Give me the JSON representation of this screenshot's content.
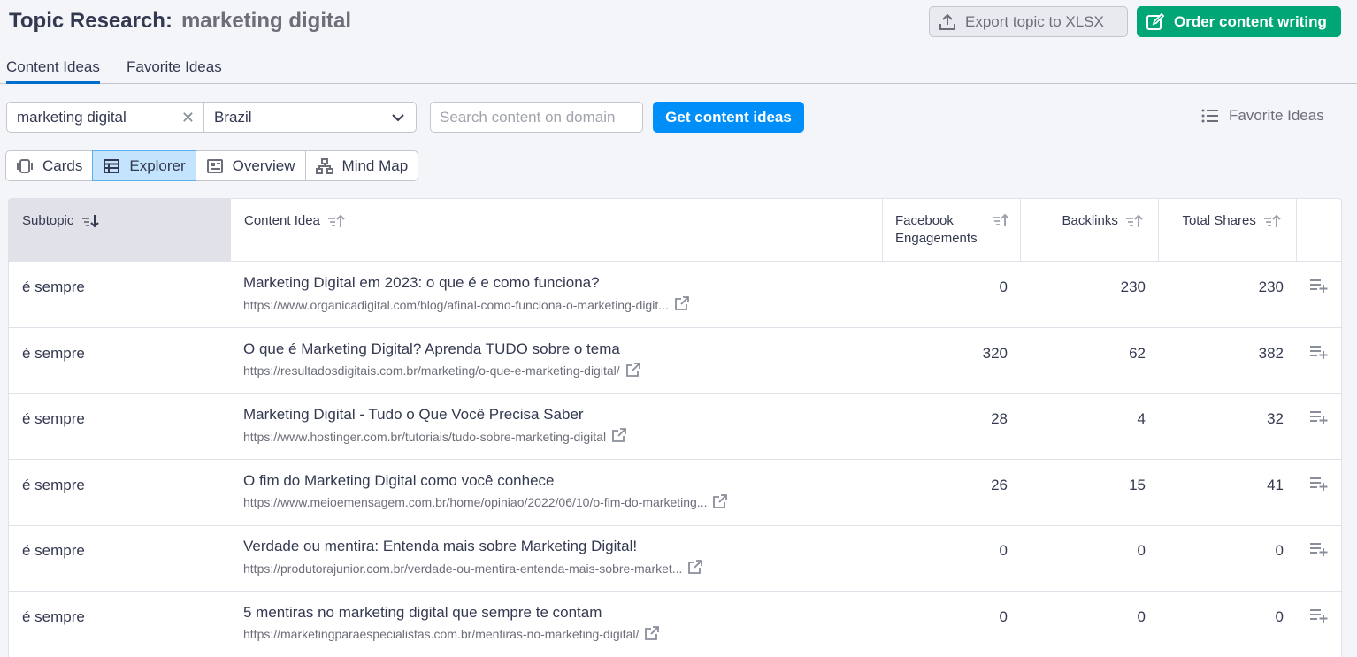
{
  "header": {
    "title": "Topic Research:",
    "keyword": "marketing digital",
    "export_label": "Export topic to XLSX",
    "order_label": "Order content writing"
  },
  "tabs": [
    {
      "label": "Content Ideas",
      "active": true
    },
    {
      "label": "Favorite Ideas",
      "active": false
    }
  ],
  "search": {
    "keyword_value": "marketing digital",
    "country": "Brazil",
    "domain_placeholder": "Search content on domain",
    "submit_label": "Get content ideas",
    "favorites_label": "Favorite Ideas"
  },
  "views": [
    {
      "label": "Cards",
      "icon": "cards-icon",
      "active": false
    },
    {
      "label": "Explorer",
      "icon": "table-icon",
      "active": true
    },
    {
      "label": "Overview",
      "icon": "overview-icon",
      "active": false
    },
    {
      "label": "Mind Map",
      "icon": "mindmap-icon",
      "active": false
    }
  ],
  "table": {
    "columns": {
      "subtopic": "Subtopic",
      "idea": "Content Idea",
      "fb_line1": "Facebook",
      "fb_line2": "Engagements",
      "backlinks": "Backlinks",
      "shares": "Total Shares"
    },
    "rows": [
      {
        "subtopic": "é sempre",
        "title": "Marketing Digital em 2023: o que é e como funciona?",
        "url": "https://www.organicadigital.com/blog/afinal-como-funciona-o-marketing-digit...",
        "fb": "0",
        "backlinks": "230",
        "shares": "230"
      },
      {
        "subtopic": "é sempre",
        "title": "O que é Marketing Digital? Aprenda TUDO sobre o tema",
        "url": "https://resultadosdigitais.com.br/marketing/o-que-e-marketing-digital/",
        "fb": "320",
        "backlinks": "62",
        "shares": "382"
      },
      {
        "subtopic": "é sempre",
        "title": "Marketing Digital - Tudo o Que Você Precisa Saber",
        "url": "https://www.hostinger.com.br/tutoriais/tudo-sobre-marketing-digital",
        "fb": "28",
        "backlinks": "4",
        "shares": "32"
      },
      {
        "subtopic": "é sempre",
        "title": "O fim do Marketing Digital como você conhece",
        "url": "https://www.meioemensagem.com.br/home/opiniao/2022/06/10/o-fim-do-marketing...",
        "fb": "26",
        "backlinks": "15",
        "shares": "41"
      },
      {
        "subtopic": "é sempre",
        "title": "Verdade ou mentira: Entenda mais sobre Marketing Digital!",
        "url": "https://produtorajunior.com.br/verdade-ou-mentira-entenda-mais-sobre-market...",
        "fb": "0",
        "backlinks": "0",
        "shares": "0"
      },
      {
        "subtopic": "é sempre",
        "title": "5 mentiras no marketing digital que sempre te contam",
        "url": "https://marketingparaespecialistas.com.br/mentiras-no-marketing-digital/",
        "fb": "0",
        "backlinks": "0",
        "shares": "0"
      }
    ]
  },
  "colors": {
    "accent_blue": "#008ff8",
    "order_green": "#00a676",
    "active_view_bg": "#c3e4fc"
  }
}
